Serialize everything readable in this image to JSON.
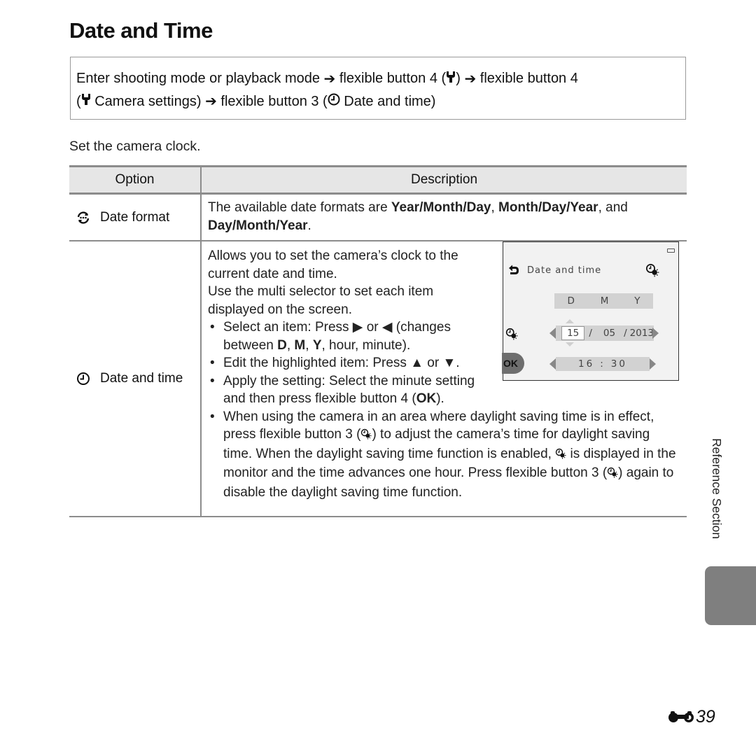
{
  "page": {
    "title": "Date and Time",
    "procedure": {
      "line1": {
        "part1": "Enter shooting mode or playback mode",
        "part2": "flexible button 4 (",
        "part3": ")",
        "part4": "flexible button 4"
      },
      "line2": {
        "part1": "(",
        "part2": "Camera settings)",
        "part3": "flexible button 3 (",
        "part4": "Date and time)"
      }
    },
    "intro": "Set the camera clock.",
    "table": {
      "headers": [
        "Option",
        "Description"
      ],
      "rows": [
        {
          "option": "Date format",
          "icon": "date-format-icon",
          "desc": {
            "pre": "The available date formats are ",
            "b1": "Year/Month/Day",
            "sep1": ", ",
            "b2": "Month/Day/Year",
            "sep2": ", and",
            "b3": "Day/Month/Year",
            "end": "."
          }
        },
        {
          "option": "Date and time",
          "icon": "clock-icon",
          "desc": {
            "p1": "Allows you to set the camera’s clock to the current date and time.",
            "p2": "Use the multi selector to set each item displayed on the screen.",
            "b1_pre": "Select an item: Press ",
            "b1_mid": " or ",
            "b1_post": " (changes between ",
            "b1_D": "D",
            "b1_c1": ", ",
            "b1_M": "M",
            "b1_c2": ", ",
            "b1_Y": "Y",
            "b1_end": ", hour, minute).",
            "b2_pre": "Edit the highlighted item: Press ",
            "b2_mid": " or ",
            "b2_end": ".",
            "b3_pre": "Apply the setting: Select the minute setting and then press flexible button 4 (",
            "b3_ok": "OK",
            "b3_end": ").",
            "b4_pre": "When using the camera in an area where daylight saving time is in effect, press flexible button 3 (",
            "b4_mid1": ") to adjust the camera’s time for daylight saving time. When the daylight saving time function is enabled, ",
            "b4_mid2": " is displayed in the monitor and the time advances one hour. Press flexible button 3 (",
            "b4_end": ") again to disable the daylight saving time function."
          }
        }
      ]
    },
    "camera_screen": {
      "header": "Date and time",
      "columns": [
        "D",
        "M",
        "Y"
      ],
      "day": "15",
      "sep1": "/",
      "month": "05",
      "sep2": "/",
      "year": "2013",
      "hour": "16",
      "time_sep": ":",
      "minute": "30",
      "ok_label": "OK"
    },
    "side_label": "Reference Section",
    "page_number": "39",
    "colors": {
      "tab_gray": "#7f7f7f",
      "header_bg": "#e6e6e6",
      "rule": "#8c8c8c"
    }
  }
}
